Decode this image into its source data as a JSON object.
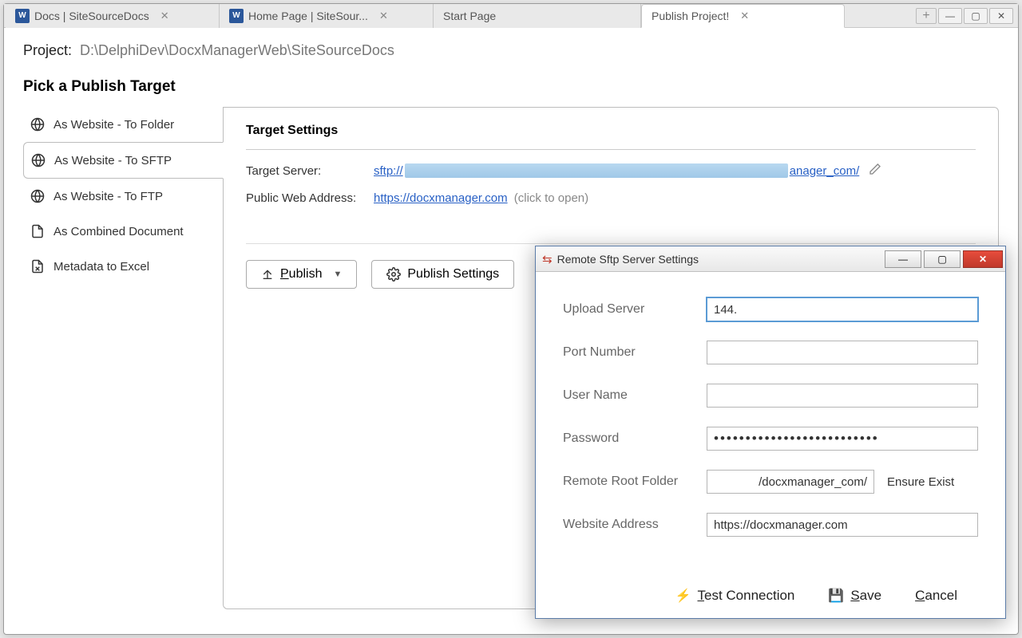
{
  "tabs": {
    "items": [
      {
        "label": "Docs | SiteSourceDocs",
        "icon": "word"
      },
      {
        "label": "Home Page | SiteSour...",
        "icon": "word"
      },
      {
        "label": "Start Page",
        "icon": null
      },
      {
        "label": "Publish Project!",
        "icon": null,
        "active": true
      }
    ]
  },
  "project": {
    "label": "Project:",
    "path": "D:\\DelphiDev\\DocxManagerWeb\\SiteSourceDocs"
  },
  "heading": "Pick a Publish Target",
  "targets": [
    {
      "label": "As Website - To Folder",
      "icon": "globe"
    },
    {
      "label": "As Website - To SFTP",
      "icon": "globe",
      "selected": true
    },
    {
      "label": "As Website - To FTP",
      "icon": "globe"
    },
    {
      "label": "As Combined Document",
      "icon": "doc"
    },
    {
      "label": "Metadata to Excel",
      "icon": "file"
    }
  ],
  "settings": {
    "heading": "Target Settings",
    "target_server_label": "Target Server:",
    "target_server_prefix": "sftp://",
    "target_server_suffix": "anager_com/",
    "public_web_label": "Public Web Address:",
    "public_web_value": "https://docxmanager.com",
    "public_web_hint": "(click to open)"
  },
  "buttons": {
    "publish": "Publish",
    "publish_settings": "Publish Settings"
  },
  "dialog": {
    "title": "Remote Sftp Server Settings",
    "upload_server_label": "Upload Server",
    "upload_server_value": "144.",
    "port_label": "Port Number",
    "port_value": "",
    "user_label": "User Name",
    "user_value": "",
    "password_label": "Password",
    "password_value": "••••••••••••••••••••••••••",
    "root_label": "Remote Root Folder",
    "root_value": "          /docxmanager_com/",
    "ensure_exist": "Ensure Exist",
    "website_label": "Website Address",
    "website_value": "https://docxmanager.com",
    "test_connection": "est Connection",
    "test_prefix": "T",
    "save": "ave",
    "save_prefix": "S",
    "cancel_prefix": "C",
    "cancel": "ancel"
  }
}
